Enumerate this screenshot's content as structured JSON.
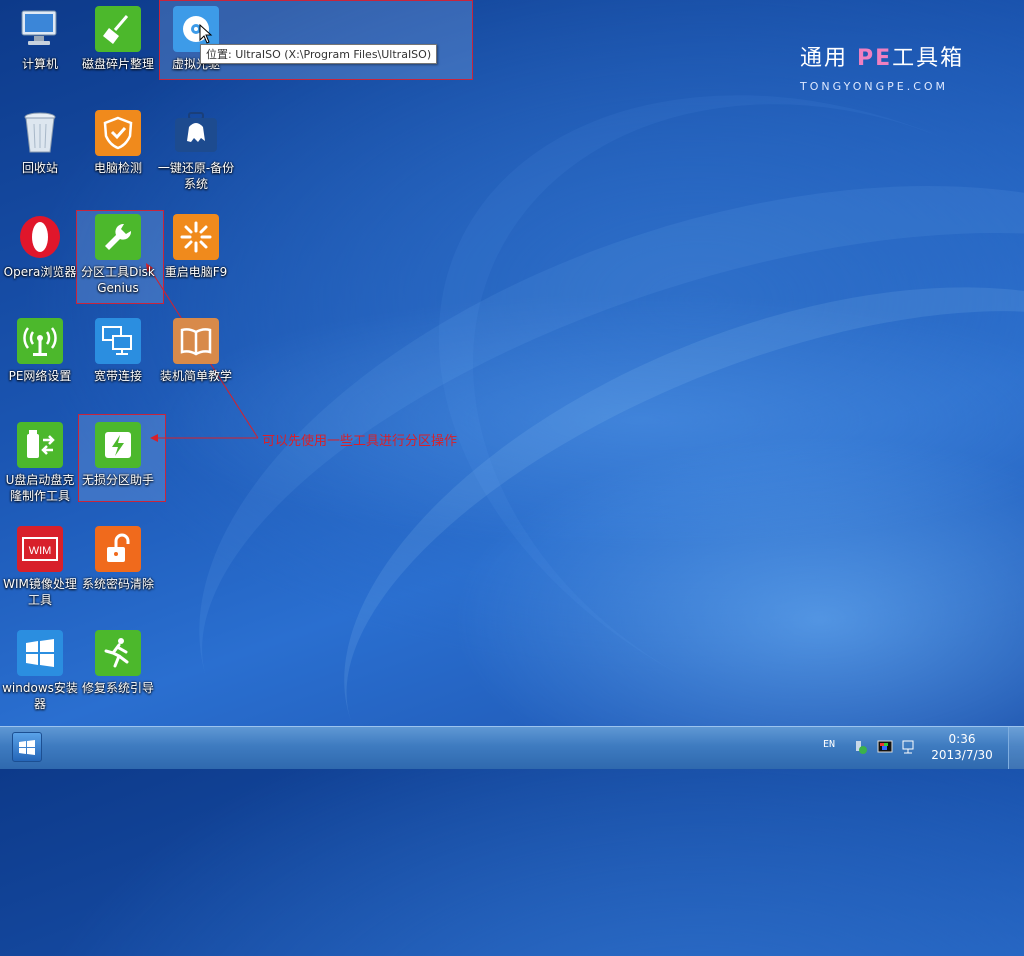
{
  "desktop": {
    "icons": [
      {
        "label": "计算机",
        "icon": "computer-icon"
      },
      {
        "label": "磁盘碎片整理",
        "icon": "broom-icon"
      },
      {
        "label": "虚拟光驱",
        "icon": "cd-drive-icon"
      },
      {
        "label": "回收站",
        "icon": "recycle-bin-icon"
      },
      {
        "label": "电脑检测",
        "icon": "shield-check-icon"
      },
      {
        "label": "一键还原-备份系统",
        "icon": "ghost-briefcase-icon"
      },
      {
        "label": "Opera浏览器",
        "icon": "opera-icon"
      },
      {
        "label": "分区工具DiskGenius",
        "icon": "wrench-icon"
      },
      {
        "label": "重启电脑F9",
        "icon": "restart-burst-icon"
      },
      {
        "label": "PE网络设置",
        "icon": "antenna-icon"
      },
      {
        "label": "宽带连接",
        "icon": "network-monitors-icon"
      },
      {
        "label": "装机简单教学",
        "icon": "book-icon"
      },
      {
        "label": "U盘启动盘克隆制作工具",
        "icon": "usb-icon"
      },
      {
        "label": "无损分区助手",
        "icon": "partition-bolt-icon"
      },
      {
        "label": "WIM镜像处理工具",
        "icon": "wim-icon"
      },
      {
        "label": "系统密码清除",
        "icon": "unlock-icon"
      },
      {
        "label": "windows安装器",
        "icon": "windows-logo-icon"
      },
      {
        "label": "修复系统引导",
        "icon": "running-man-icon"
      }
    ]
  },
  "tooltip": {
    "text": "位置: UltraISO (X:\\Program Files\\UltraISO)"
  },
  "annotation": {
    "text": "可以先使用一些工具进行分区操作",
    "color": "#d8202a"
  },
  "brand": {
    "title_prefix": "通用 ",
    "title_pe": "PE",
    "title_suffix": "工具箱",
    "subtitle": "TONGYONGPE.COM"
  },
  "taskbar": {
    "language": "EN",
    "clock_time": "0:36",
    "clock_date": "2013/7/30"
  },
  "colors": {
    "selection_border": "#c8253c",
    "accent_green": "#4caf2a",
    "accent_orange": "#f08a1c"
  }
}
